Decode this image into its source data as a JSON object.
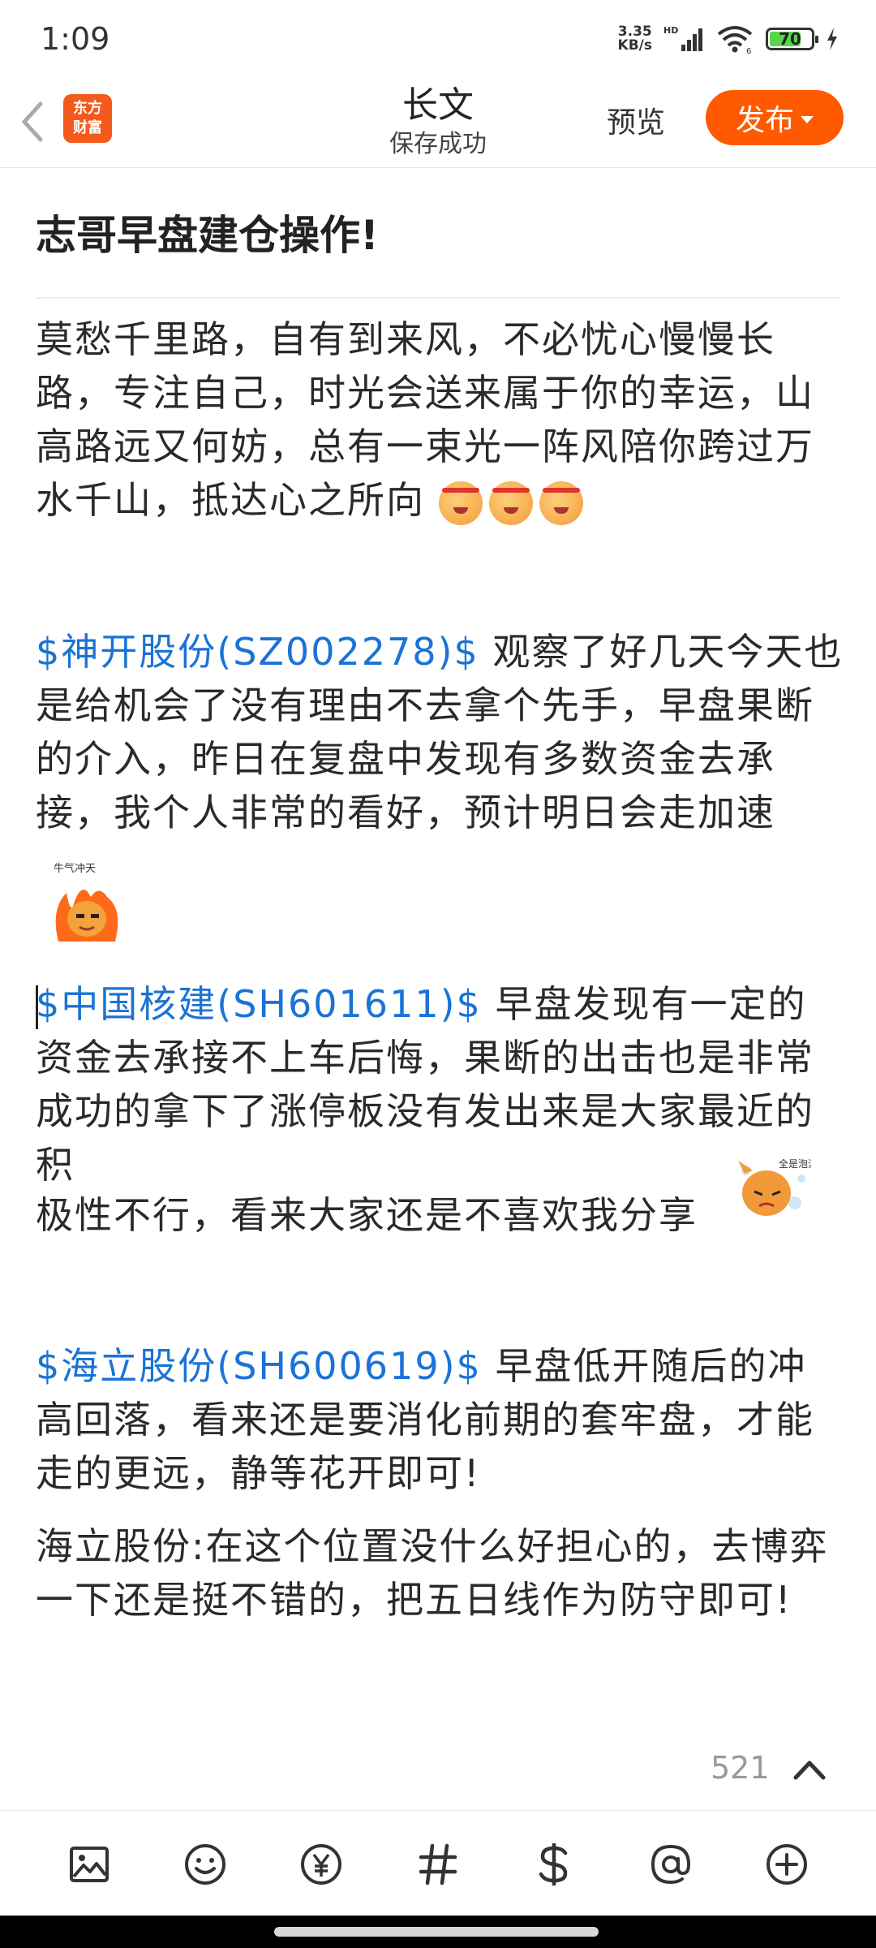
{
  "status": {
    "time": "1:09",
    "net_speed_value": "3.35",
    "net_speed_unit": "KB/s",
    "hd": "HD",
    "battery": "70"
  },
  "header": {
    "title": "长文",
    "subtitle": "保存成功",
    "preview": "预览",
    "publish": "发布",
    "logo_line1": "东方",
    "logo_line2": "财富"
  },
  "doc": {
    "title": "志哥早盘建仓操作!",
    "p1": "莫愁千里路，自有到来风，不必忧心慢慢长路，专注自己，时光会送来属于你的幸运，山高路远又何妨，总有一束光一阵风陪你跨过万水千山，抵达心之所向",
    "stock1": " $神开股份(SZ002278)$ ",
    "p2": " 观察了好几天今天也是给机会了没有理由不去拿个先手，早盘果断的介入，昨日在复盘中发现有多数资金去承接，我个人非常的看好，预计明日会走加速",
    "sticker1_text": "牛气冲天",
    "stock2": "$中国核建(SH601611)$",
    "p3a": "  早盘发现有一定的资金去承接不上车后悔，果断的出击也是非常成功的拿下了涨停板没有发出来是大家最近的积",
    "p3b": "极性不行，看来大家还是不喜欢我分享",
    "sticker2_text": "全是泡沫",
    "stock3": " $海立股份(SH600619)$ ",
    "p4": " 早盘低开随后的冲高回落，看来还是要消化前期的套牢盘，才能走的更远，静等花开即可!",
    "p5": "海立股份:在这个位置没什么好担心的，去博弈一下还是挺不错的，把五日线作为防守即可!"
  },
  "footer": {
    "word_count": "521"
  },
  "colors": {
    "accent": "#ff5a00",
    "stock_link": "#1a73d6"
  },
  "toolbar_icons": [
    "image-icon",
    "emoji-icon",
    "yuan-icon",
    "hashtag-icon",
    "dollar-icon",
    "at-icon",
    "plus-circle-icon"
  ]
}
